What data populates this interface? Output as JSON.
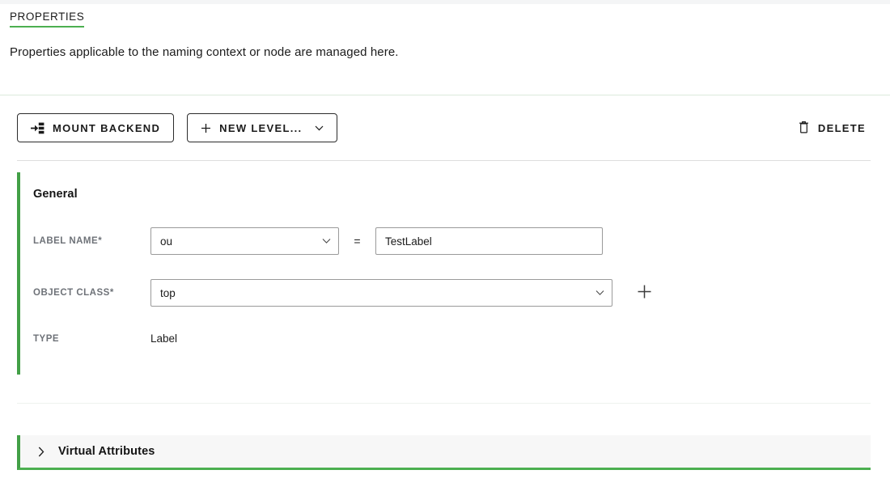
{
  "header": {
    "title": "PROPERTIES",
    "subtitle": "Properties applicable to the naming context or node are managed here.",
    "accent_color": "#4caf50"
  },
  "toolbar": {
    "mount_backend_label": "MOUNT BACKEND",
    "mount_backend_icon": "server-import-icon",
    "new_level_label": "NEW LEVEL...",
    "new_level_icon": "plus-icon",
    "new_level_chevron": "chevron-down-icon",
    "delete_label": "DELETE",
    "delete_icon": "trash-icon"
  },
  "general": {
    "heading": "General",
    "fields": {
      "label_name": {
        "label": "LABEL NAME",
        "required_marker": "*",
        "select_value": "ou",
        "operator": "=",
        "text_value": "TestLabel",
        "text_placeholder": ""
      },
      "object_class": {
        "label": "OBJECT CLASS",
        "required_marker": "*",
        "select_value": "top",
        "add_icon": "plus-icon"
      },
      "type": {
        "label": "TYPE",
        "value": "Label"
      }
    }
  },
  "virtual_attributes": {
    "title": "Virtual Attributes",
    "expand_icon": "chevron-right-icon",
    "expanded": false
  }
}
